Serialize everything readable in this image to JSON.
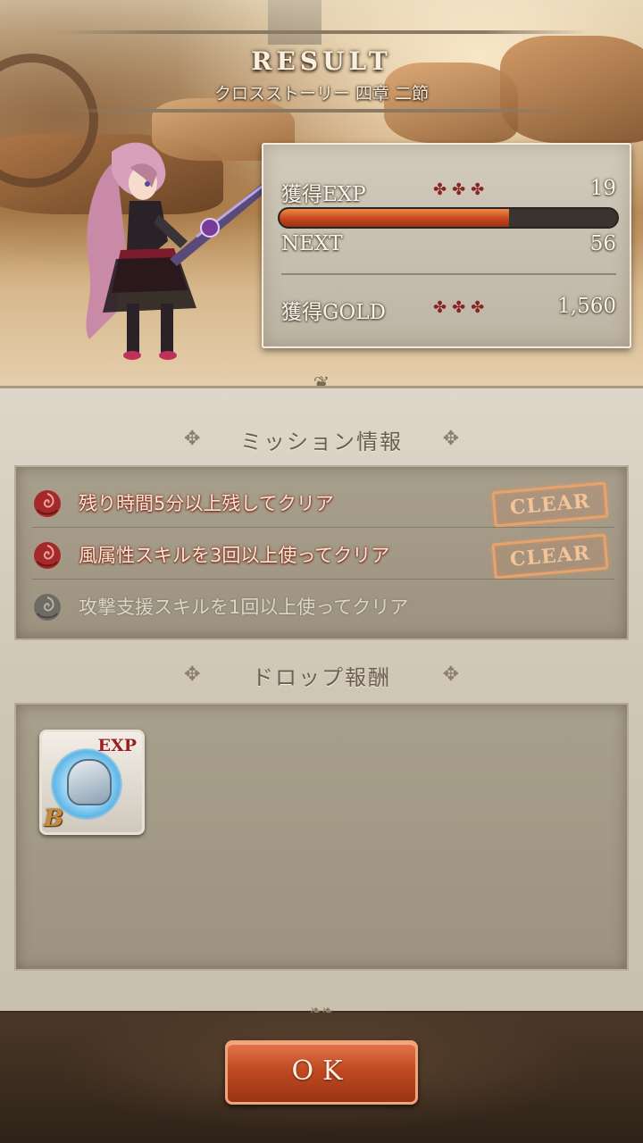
{
  "header": {
    "title": "RESULT",
    "subtitle": "クロスストーリー 四章 二節"
  },
  "stats": {
    "exp_label": "獲得EXP",
    "exp_value": "19",
    "exp_crosses": "✤✤✤",
    "exp_progress": 0.68,
    "next_label": "NEXT",
    "next_value": "56",
    "gold_label": "獲得GOLD",
    "gold_crosses": "✤✤✤",
    "gold_value": "1,560"
  },
  "missions": {
    "title": "ミッション情報",
    "items": [
      {
        "text": "残り時間5分以上残してクリア",
        "status": "CLEAR",
        "cleared": true
      },
      {
        "text": "風属性スキルを3回以上使ってクリア",
        "status": "CLEAR",
        "cleared": true
      },
      {
        "text": "攻撃支援スキルを1回以上使ってクリア",
        "status": "",
        "cleared": false
      }
    ]
  },
  "drops": {
    "title": "ドロップ報酬",
    "items": [
      {
        "badge": "EXP",
        "rank": "B",
        "icon": "helmet-icon"
      }
    ]
  },
  "ok_button": {
    "label": "OK"
  },
  "colors": {
    "accent_orange": "#c04a22",
    "exp_fill": "#d4521e",
    "rose_red": "#a42a2a",
    "rose_gray": "#6e6a64",
    "stamp": "#e8a36c"
  }
}
